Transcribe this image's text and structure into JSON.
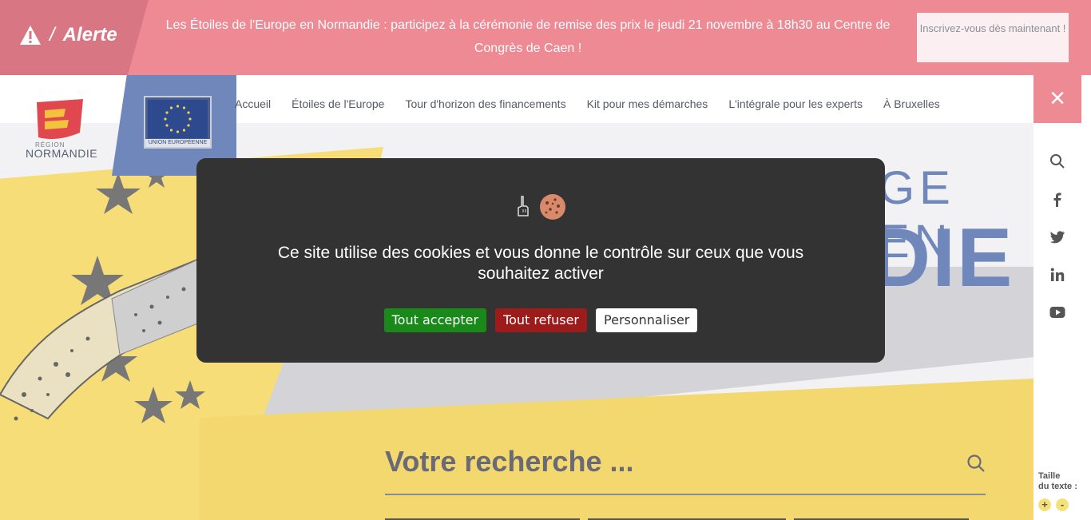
{
  "alert": {
    "label": "Alerte",
    "separator": "/",
    "message": "Les Étoiles de l'Europe en Normandie : participez à la cérémonie de remise des prix le jeudi 21 novembre à 18h30 au Centre de Congrès de Caen !",
    "cta": "Inscrivez-vous dès maintenant !"
  },
  "header": {
    "logo_small": "RÉGION",
    "logo_text": "NORMANDIE",
    "eu_caption": "UNION EUROPÉENNE",
    "nav": [
      "Accueil",
      "Étoiles de l'Europe",
      "Tour d'horizon des financements",
      "Kit pour mes démarches",
      "L'intégrale pour les experts",
      "À Bruxelles"
    ],
    "close_label": "×"
  },
  "hero": {
    "title_line1": "GE EN",
    "title_line2": "DIE"
  },
  "search": {
    "placeholder": "Votre recherche ..."
  },
  "text_size": {
    "label_line1": "Taille",
    "label_line2": "du texte :",
    "plus": "+",
    "minus": "-"
  },
  "cookie": {
    "message": "Ce site utilise des cookies et vous donne le contrôle sur ceux que vous souhaitez activer",
    "accept": "Tout accepter",
    "refuse": "Tout refuser",
    "customize": "Personnaliser"
  },
  "colors": {
    "alert_bg": "#ee8a94",
    "eu_blue": "#6f87ba",
    "hero_yellow": "#f7dd78",
    "modal_bg": "#333333",
    "accept_green": "#198a1a",
    "refuse_red": "#9c1b1b"
  }
}
